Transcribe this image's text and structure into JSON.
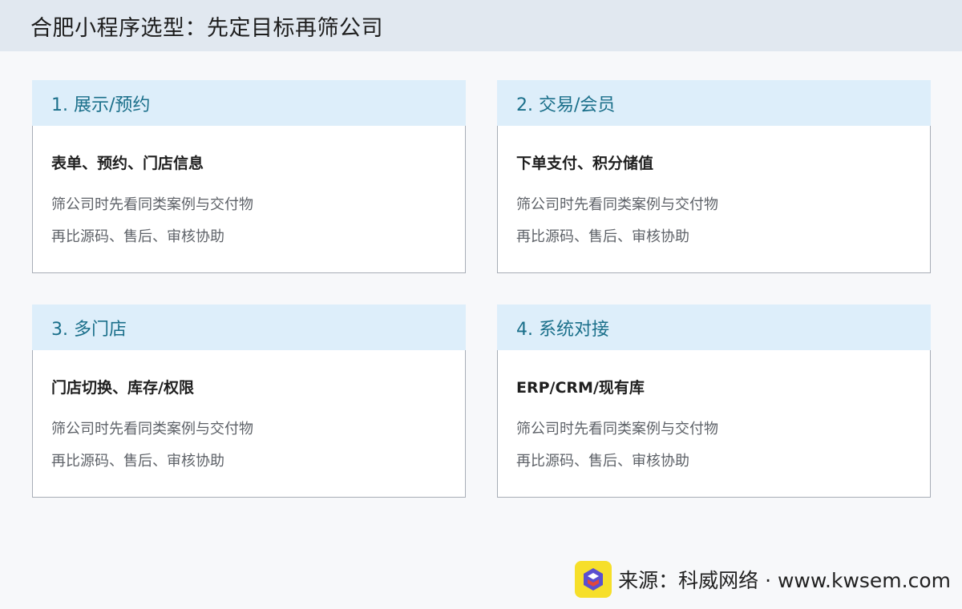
{
  "header": {
    "title": "合肥小程序选型：先定目标再筛公司"
  },
  "cards": [
    {
      "title": "1. 展示/预约",
      "subtitle": "表单、预约、门店信息",
      "line1": "筛公司时先看同类案例与交付物",
      "line2": "再比源码、售后、审核协助"
    },
    {
      "title": "2. 交易/会员",
      "subtitle": "下单支付、积分储值",
      "line1": "筛公司时先看同类案例与交付物",
      "line2": "再比源码、售后、审核协助"
    },
    {
      "title": "3. 多门店",
      "subtitle": "门店切换、库存/权限",
      "line1": "筛公司时先看同类案例与交付物",
      "line2": "再比源码、售后、审核协助"
    },
    {
      "title": "4. 系统对接",
      "subtitle": "ERP/CRM/现有库",
      "line1": "筛公司时先看同类案例与交付物",
      "line2": "再比源码、售后、审核协助"
    }
  ],
  "footer": {
    "source": "来源：科威网络 · www.kwsem.com",
    "logo_icon": "kw-logo-icon"
  },
  "colors": {
    "header_bg": "#e1e8f0",
    "card_head_bg": "#ddeefa",
    "card_title": "#1a6f8a",
    "logo_bg": "#f6df2a"
  }
}
